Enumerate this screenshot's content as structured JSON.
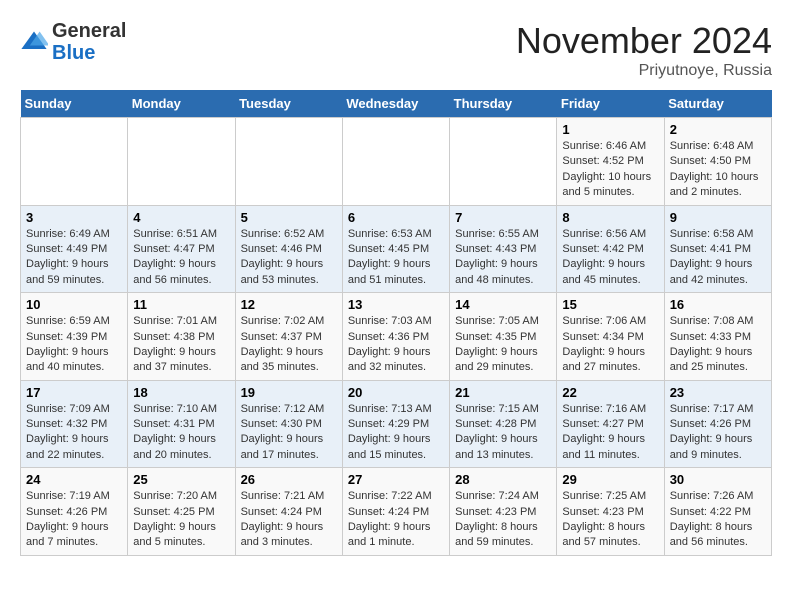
{
  "header": {
    "logo_general": "General",
    "logo_blue": "Blue",
    "month_title": "November 2024",
    "location": "Priyutnoye, Russia"
  },
  "days_of_week": [
    "Sunday",
    "Monday",
    "Tuesday",
    "Wednesday",
    "Thursday",
    "Friday",
    "Saturday"
  ],
  "weeks": [
    [
      {
        "day": "",
        "info": ""
      },
      {
        "day": "",
        "info": ""
      },
      {
        "day": "",
        "info": ""
      },
      {
        "day": "",
        "info": ""
      },
      {
        "day": "",
        "info": ""
      },
      {
        "day": "1",
        "info": "Sunrise: 6:46 AM\nSunset: 4:52 PM\nDaylight: 10 hours and 5 minutes."
      },
      {
        "day": "2",
        "info": "Sunrise: 6:48 AM\nSunset: 4:50 PM\nDaylight: 10 hours and 2 minutes."
      }
    ],
    [
      {
        "day": "3",
        "info": "Sunrise: 6:49 AM\nSunset: 4:49 PM\nDaylight: 9 hours and 59 minutes."
      },
      {
        "day": "4",
        "info": "Sunrise: 6:51 AM\nSunset: 4:47 PM\nDaylight: 9 hours and 56 minutes."
      },
      {
        "day": "5",
        "info": "Sunrise: 6:52 AM\nSunset: 4:46 PM\nDaylight: 9 hours and 53 minutes."
      },
      {
        "day": "6",
        "info": "Sunrise: 6:53 AM\nSunset: 4:45 PM\nDaylight: 9 hours and 51 minutes."
      },
      {
        "day": "7",
        "info": "Sunrise: 6:55 AM\nSunset: 4:43 PM\nDaylight: 9 hours and 48 minutes."
      },
      {
        "day": "8",
        "info": "Sunrise: 6:56 AM\nSunset: 4:42 PM\nDaylight: 9 hours and 45 minutes."
      },
      {
        "day": "9",
        "info": "Sunrise: 6:58 AM\nSunset: 4:41 PM\nDaylight: 9 hours and 42 minutes."
      }
    ],
    [
      {
        "day": "10",
        "info": "Sunrise: 6:59 AM\nSunset: 4:39 PM\nDaylight: 9 hours and 40 minutes."
      },
      {
        "day": "11",
        "info": "Sunrise: 7:01 AM\nSunset: 4:38 PM\nDaylight: 9 hours and 37 minutes."
      },
      {
        "day": "12",
        "info": "Sunrise: 7:02 AM\nSunset: 4:37 PM\nDaylight: 9 hours and 35 minutes."
      },
      {
        "day": "13",
        "info": "Sunrise: 7:03 AM\nSunset: 4:36 PM\nDaylight: 9 hours and 32 minutes."
      },
      {
        "day": "14",
        "info": "Sunrise: 7:05 AM\nSunset: 4:35 PM\nDaylight: 9 hours and 29 minutes."
      },
      {
        "day": "15",
        "info": "Sunrise: 7:06 AM\nSunset: 4:34 PM\nDaylight: 9 hours and 27 minutes."
      },
      {
        "day": "16",
        "info": "Sunrise: 7:08 AM\nSunset: 4:33 PM\nDaylight: 9 hours and 25 minutes."
      }
    ],
    [
      {
        "day": "17",
        "info": "Sunrise: 7:09 AM\nSunset: 4:32 PM\nDaylight: 9 hours and 22 minutes."
      },
      {
        "day": "18",
        "info": "Sunrise: 7:10 AM\nSunset: 4:31 PM\nDaylight: 9 hours and 20 minutes."
      },
      {
        "day": "19",
        "info": "Sunrise: 7:12 AM\nSunset: 4:30 PM\nDaylight: 9 hours and 17 minutes."
      },
      {
        "day": "20",
        "info": "Sunrise: 7:13 AM\nSunset: 4:29 PM\nDaylight: 9 hours and 15 minutes."
      },
      {
        "day": "21",
        "info": "Sunrise: 7:15 AM\nSunset: 4:28 PM\nDaylight: 9 hours and 13 minutes."
      },
      {
        "day": "22",
        "info": "Sunrise: 7:16 AM\nSunset: 4:27 PM\nDaylight: 9 hours and 11 minutes."
      },
      {
        "day": "23",
        "info": "Sunrise: 7:17 AM\nSunset: 4:26 PM\nDaylight: 9 hours and 9 minutes."
      }
    ],
    [
      {
        "day": "24",
        "info": "Sunrise: 7:19 AM\nSunset: 4:26 PM\nDaylight: 9 hours and 7 minutes."
      },
      {
        "day": "25",
        "info": "Sunrise: 7:20 AM\nSunset: 4:25 PM\nDaylight: 9 hours and 5 minutes."
      },
      {
        "day": "26",
        "info": "Sunrise: 7:21 AM\nSunset: 4:24 PM\nDaylight: 9 hours and 3 minutes."
      },
      {
        "day": "27",
        "info": "Sunrise: 7:22 AM\nSunset: 4:24 PM\nDaylight: 9 hours and 1 minute."
      },
      {
        "day": "28",
        "info": "Sunrise: 7:24 AM\nSunset: 4:23 PM\nDaylight: 8 hours and 59 minutes."
      },
      {
        "day": "29",
        "info": "Sunrise: 7:25 AM\nSunset: 4:23 PM\nDaylight: 8 hours and 57 minutes."
      },
      {
        "day": "30",
        "info": "Sunrise: 7:26 AM\nSunset: 4:22 PM\nDaylight: 8 hours and 56 minutes."
      }
    ]
  ]
}
